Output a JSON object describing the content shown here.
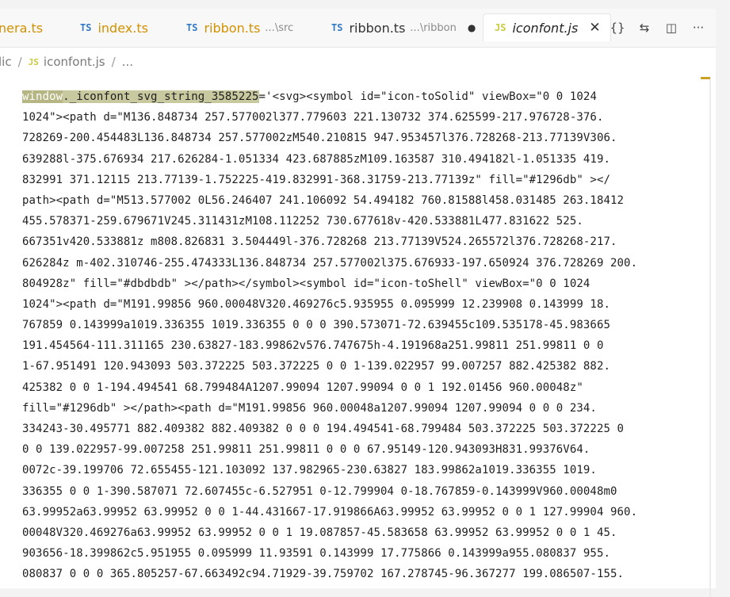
{
  "tabs": [
    {
      "icon": "",
      "name": "nera.ts",
      "suffix": "",
      "state": ""
    },
    {
      "icon": "TS",
      "name": "index.ts",
      "suffix": "",
      "state": ""
    },
    {
      "icon": "TS",
      "name": "ribbon.ts",
      "suffix": "...\\src",
      "state": ""
    },
    {
      "icon": "TS",
      "name": "ribbon.ts",
      "suffix": "...\\ribbon",
      "state": "●"
    },
    {
      "icon": "JS",
      "name": "iconfont.js",
      "suffix": "",
      "state": "✕"
    }
  ],
  "breadcrumb": {
    "part1": "lic",
    "sep1": "/",
    "icon": "JS",
    "file": "iconfont.js",
    "sep2": "/",
    "more": "..."
  },
  "code": {
    "l1_hl1": "window",
    "l1_hl2": "._iconfont_svg_string_3585225",
    "l1_rest": "='<svg><symbol id=\"icon-toSolid\" viewBox=\"0 0 1024",
    "lines": [
      "1024\"><path d=\"M136.848734 257.577002l377.779603 221.130732 374.625599-217.976728-376.",
      "728269-200.454483L136.848734 257.577002zM540.210815 947.953457l376.728268-213.77139V306.",
      "639288l-375.676934 217.626284-1.051334 423.687885zM109.163587 310.494182l-1.051335 419.",
      "832991 371.12115 213.77139-1.752225-419.832991-368.31759-213.77139z\" fill=\"#1296db\" ></",
      "path><path d=\"M513.577002 0L56.246407 241.106092 54.494182 760.81588l458.031485 263.18412",
      "455.578371-259.679671V245.311431zM108.112252 730.677618v-420.533881L477.831622 525.",
      "667351v420.533881z m808.826831 3.504449l-376.728268 213.77139V524.265572l376.728268-217.",
      "626284z m-402.310746-255.474333L136.848734 257.577002l375.676933-197.650924 376.728269 200.",
      "804928z\" fill=\"#dbdbdb\" ></path></symbol><symbol id=\"icon-toShell\" viewBox=\"0 0 1024",
      "1024\"><path d=\"M191.99856 960.00048V320.469276c5.935955 0.095999 12.239908 0.143999 18.",
      "767859 0.143999a1019.336355 1019.336355 0 0 0 390.573071-72.639455c109.535178-45.983665",
      "191.454564-111.311165 230.63827-183.99862v576.747675h-4.191968a251.99811 251.99811 0 0",
      "1-67.951491 120.943093 503.372225 503.372225 0 0 1-139.022957 99.007257 882.425382 882.",
      "425382 0 0 1-194.494541 68.799484A1207.99094 1207.99094 0 0 1 192.01456 960.00048z\"",
      "fill=\"#1296db\" ></path><path d=\"M191.99856 960.00048a1207.99094 1207.99094 0 0 0 234.",
      "334243-30.495771 882.409382 882.409382 0 0 0 194.494541-68.799484 503.372225 503.372225 0",
      "0 0 139.022957-99.007258 251.99811 251.99811 0 0 0 67.95149-120.943093H831.99376V64.",
      "0072c-39.199706 72.655455-121.103092 137.982965-230.63827 183.99862a1019.336355 1019.",
      "336355 0 0 1-390.587071 72.607455c-6.527951 0-12.799904 0-18.767859-0.143999V960.00048m0",
      "63.99952a63.99952 63.99952 0 0 1-44.431667-17.919866A63.99952 63.99952 0 0 1 127.99904 960.",
      "00048V320.469276a63.99952 63.99952 0 0 1 19.087857-45.583658 63.99952 63.99952 0 0 1 45.",
      "903656-18.399862c5.951955 0.095999 11.93591 0.143999 17.775866 0.143999a955.080837 955.",
      "080837 0 0 0 365.805257-67.663492c94.71929-39.759702 167.278745-96.367277 199.086507-155."
    ]
  },
  "actions": [
    "{}",
    "⇆",
    "◫",
    "···"
  ]
}
